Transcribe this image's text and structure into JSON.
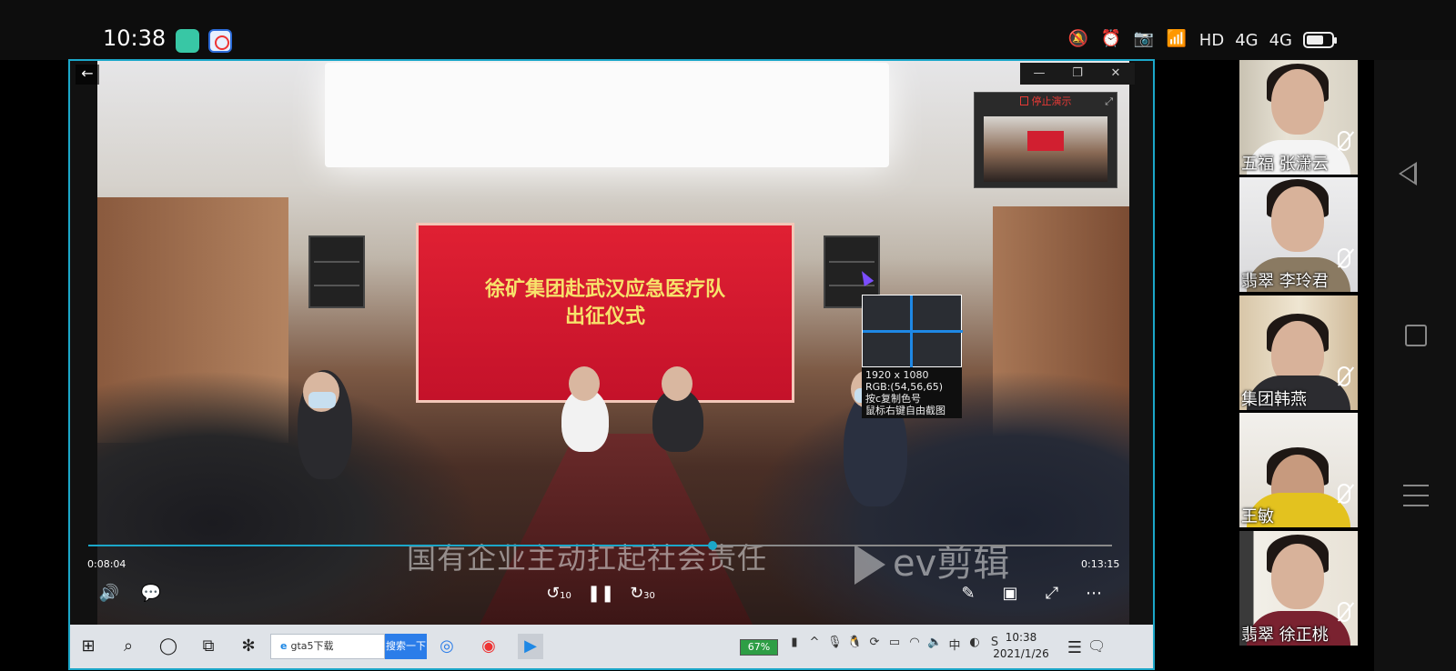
{
  "status_bar": {
    "time": "10:38",
    "icons": [
      "mute-icon",
      "alarm-icon",
      "camera-icon",
      "wifi-icon",
      "hd-icon",
      "signal-4g-icon",
      "signal-4g-icon",
      "battery-icon"
    ],
    "hd_label": "HD",
    "net1": "4G",
    "net2": "4G"
  },
  "video": {
    "banner_line1": "徐矿集团赴武汉应急医疗队",
    "banner_line2": "出征仪式",
    "subtitle": "国有企业主动扛起社会责任",
    "watermark": "ev剪辑",
    "current_time": "0:08:04",
    "total_time": "0:13:15",
    "progress": 0.61
  },
  "pip": {
    "stop_label": "停止演示"
  },
  "magnifier": {
    "resolution": "1920 x 1080",
    "rgb": "RGB:(54,56,65)",
    "hint1": "按c复制色号",
    "hint2": "鼠标右键自由截图"
  },
  "taskbar": {
    "search_value": "gta5下载",
    "search_button": "搜索一下",
    "battery": "67%",
    "clock_time": "10:38",
    "clock_date": "2021/1/26"
  },
  "participants": [
    {
      "name": "五福 张潇云"
    },
    {
      "name": "翡翠 李玲君"
    },
    {
      "name": "集团韩燕"
    },
    {
      "name": "王敏"
    },
    {
      "name": "翡翠 徐正桃"
    }
  ]
}
